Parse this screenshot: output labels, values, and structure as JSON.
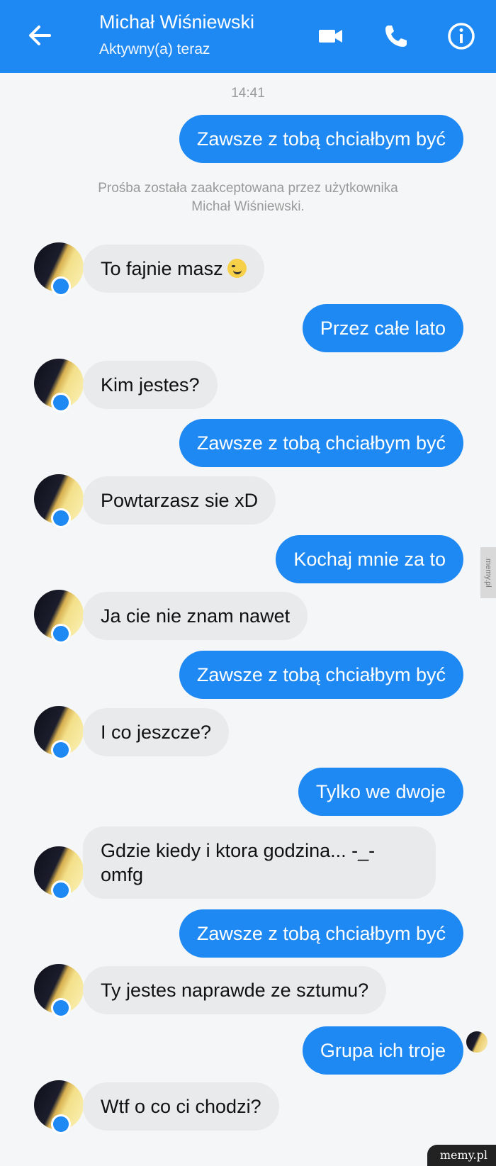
{
  "header": {
    "contact_name": "Michał Wiśniewski",
    "status": "Aktywny(a) teraz",
    "icons": [
      "back-arrow-icon",
      "video-camera-icon",
      "phone-icon",
      "info-icon"
    ]
  },
  "chat": {
    "timestamp": "14:41",
    "notice": "Prośba została zaakceptowana przez użytkownika Michał Wiśniewski.",
    "messages": [
      {
        "dir": "sent",
        "text": "Zawsze z tobą chciałbym być"
      },
      {
        "dir": "recv",
        "text": "To fajnie masz"
      },
      {
        "dir": "sent",
        "text": "Przez całe lato"
      },
      {
        "dir": "recv",
        "text": "Kim jestes?"
      },
      {
        "dir": "sent",
        "text": "Zawsze z tobą chciałbym być"
      },
      {
        "dir": "recv",
        "text": "Powtarzasz sie xD"
      },
      {
        "dir": "sent",
        "text": "Kochaj mnie za to"
      },
      {
        "dir": "recv",
        "text": "Ja cie nie znam nawet"
      },
      {
        "dir": "sent",
        "text": "Zawsze z tobą chciałbym być"
      },
      {
        "dir": "recv",
        "text": "I co jeszcze?"
      },
      {
        "dir": "sent",
        "text": "Tylko we dwoje"
      },
      {
        "dir": "recv",
        "text": "Gdzie kiedy i ktora godzina... -_- omfg"
      },
      {
        "dir": "sent",
        "text": "Zawsze z tobą chciałbym być"
      },
      {
        "dir": "recv",
        "text": "Ty jestes naprawde ze sztumu?"
      },
      {
        "dir": "sent",
        "text": "Grupa ich troje"
      },
      {
        "dir": "recv",
        "text": "Wtf o co ci chodzi?"
      }
    ]
  },
  "colors": {
    "accent": "#1e88f3",
    "received_bubble": "#e9eaec",
    "background": "#f5f6f7"
  },
  "watermark": {
    "side": "memy.pl",
    "bottom": "memy.pl"
  }
}
